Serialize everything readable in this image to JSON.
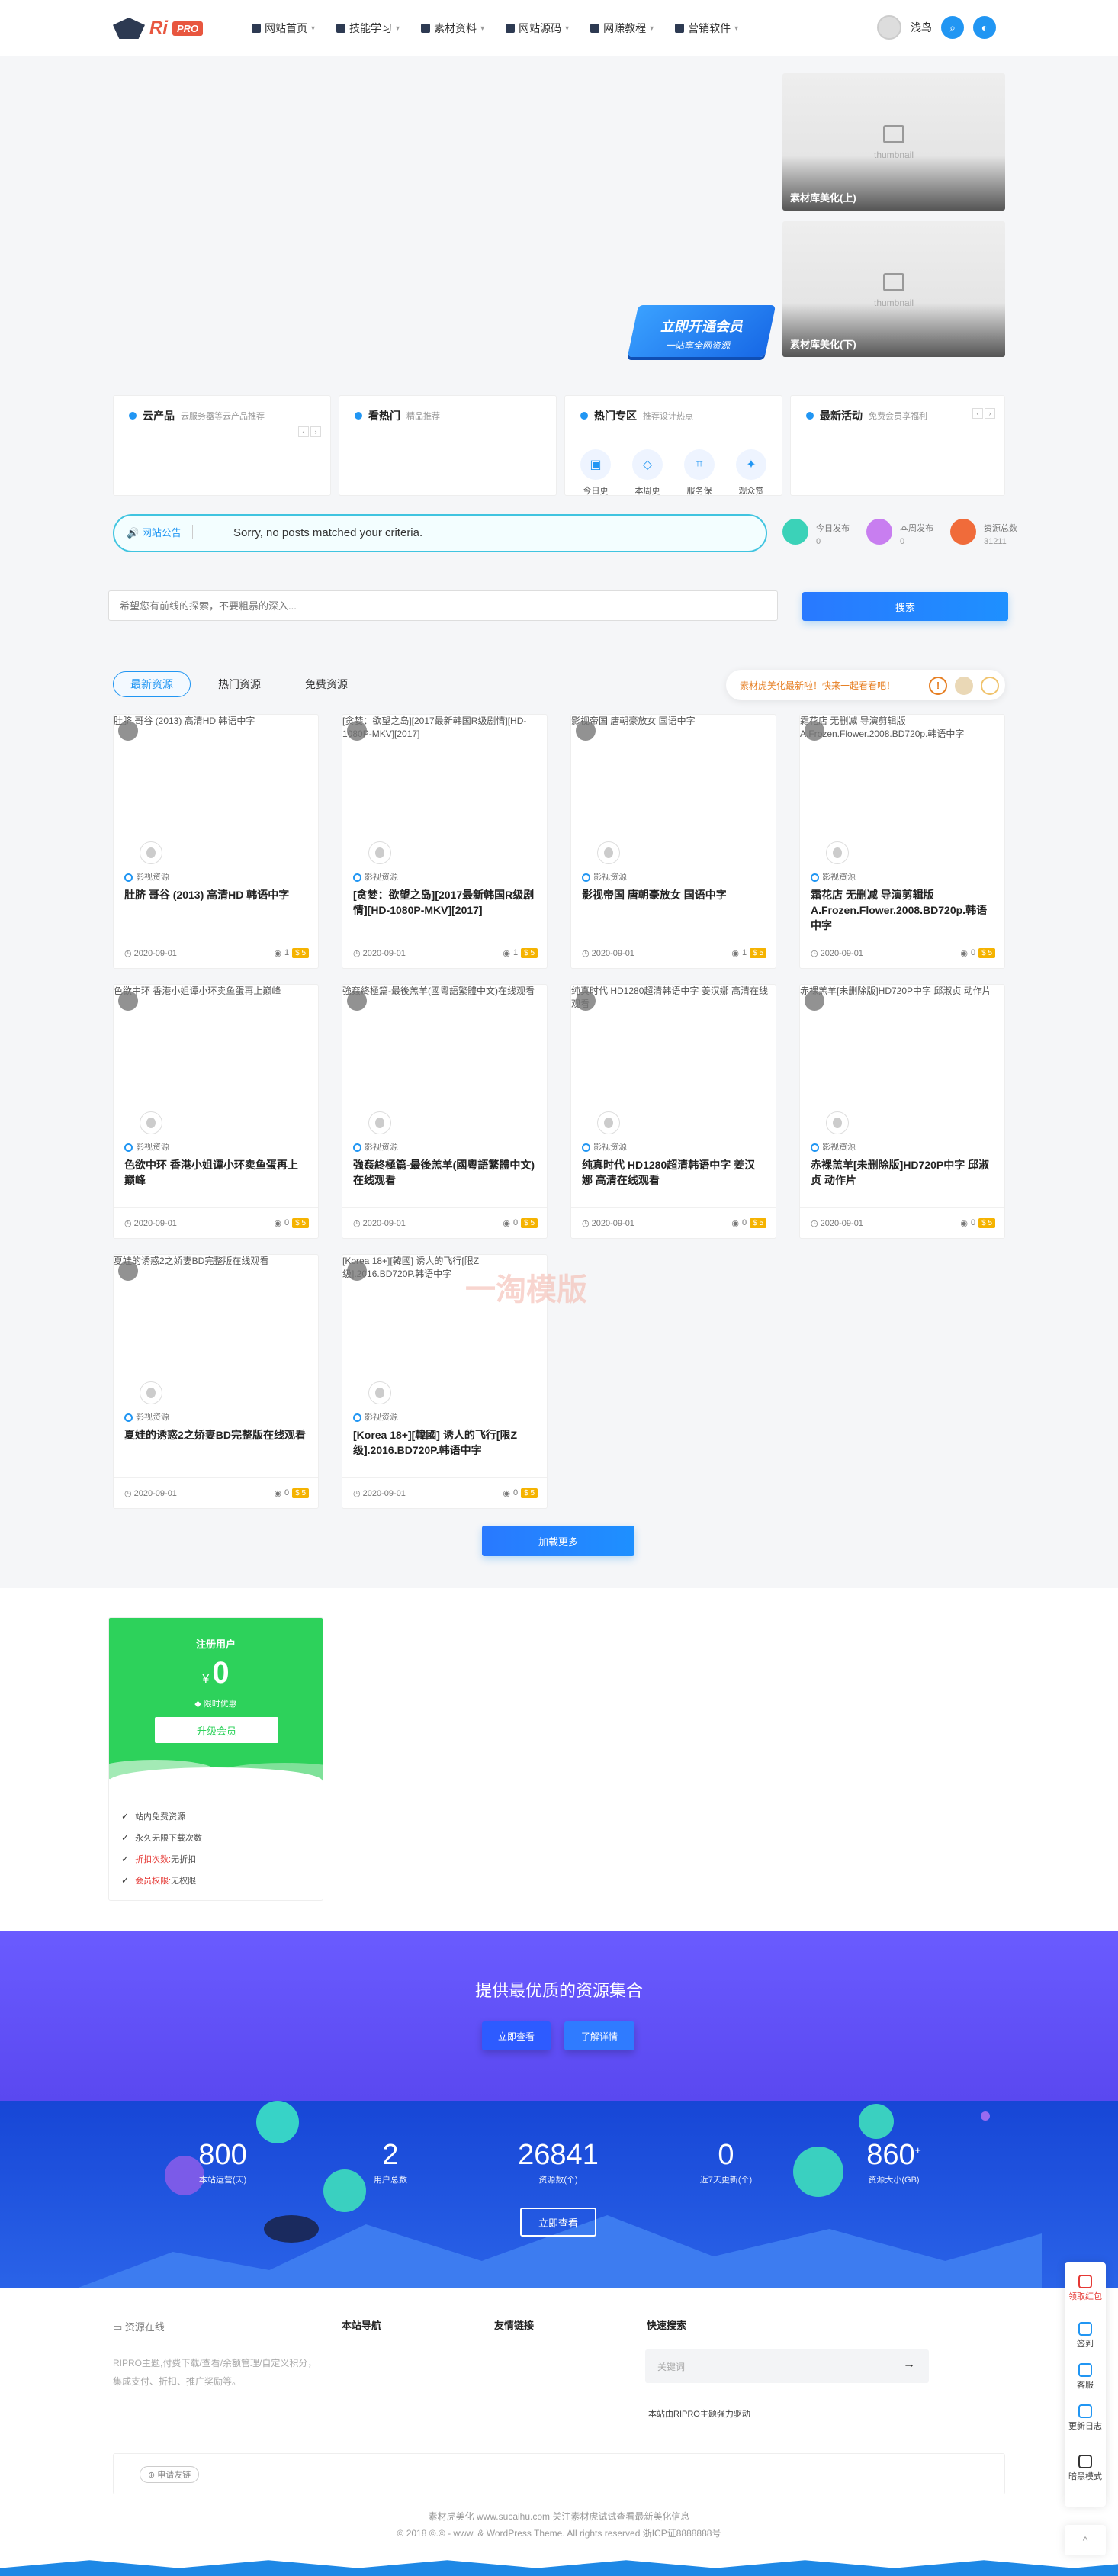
{
  "header": {
    "logo_text": "Ri",
    "logo_badge": "PRO",
    "nav": [
      {
        "label": "网站首页",
        "icon": "home-icon"
      },
      {
        "label": "技能学习",
        "icon": "send-icon"
      },
      {
        "label": "素材资料",
        "icon": "book-icon"
      },
      {
        "label": "网站源码",
        "icon": "code-icon"
      },
      {
        "label": "网赚教程",
        "icon": "grid-icon"
      },
      {
        "label": "营销软件",
        "icon": "tool-icon"
      }
    ],
    "username": "浅鸟"
  },
  "banner": {
    "thumb_placeholder": "thumbnail",
    "side_items": [
      "素材库美化(上)",
      "素材库美化(下)"
    ],
    "vip_title": "立即开通会员",
    "vip_sub": "一站享全网资源"
  },
  "boxes": [
    {
      "title": "云产品",
      "sub": "云服务器等云产品推荐"
    },
    {
      "title": "看热门",
      "sub": "精品推荐"
    },
    {
      "title": "热门专区",
      "sub": "推荐设计热点",
      "items": [
        "今日更",
        "本周更",
        "服务保",
        "观众赏"
      ]
    },
    {
      "title": "最新活动",
      "sub": "免费会员享福利"
    }
  ],
  "notice": {
    "tag": "网站公告",
    "message": "Sorry, no posts matched your criteria."
  },
  "site_stats_small": [
    {
      "label": "今日发布",
      "value": "0",
      "color": "#3bd2b8"
    },
    {
      "label": "本周发布",
      "value": "0",
      "color": "#c87ef0"
    },
    {
      "label": "资源总数",
      "value": "31211",
      "color": "#f06b3a"
    }
  ],
  "search": {
    "placeholder": "希望您有前线的探索，不要粗暴的深入...",
    "button": "搜索"
  },
  "tabs": [
    "最新资源",
    "热门资源",
    "免费资源"
  ],
  "promo": {
    "text": "素材虎美化最新啦！快来一起看看吧！",
    "icon": "!"
  },
  "posts": [
    {
      "img_alt": "肚脐 哥谷 (2013) 高清HD 韩语中字",
      "cat": "影视资源",
      "title": "肚脐 哥谷 (2013) 高清HD 韩语中字",
      "date": "2020-09-01",
      "views": "1",
      "price": "5"
    },
    {
      "img_alt": "[贪婪：欲望之岛][2017最新韩国R级剧情][HD-1080P-MKV][2017]",
      "cat": "影视资源",
      "title": "[贪婪：欲望之岛][2017最新韩国R级剧情][HD-1080P-MKV][2017]",
      "date": "2020-09-01",
      "views": "1",
      "price": "5"
    },
    {
      "img_alt": "影视帝国 唐朝豪放女 国语中字",
      "cat": "影视资源",
      "title": "影视帝国 唐朝豪放女 国语中字",
      "date": "2020-09-01",
      "views": "1",
      "price": "5"
    },
    {
      "img_alt": "霜花店 无删减 导演剪辑版 A.Frozen.Flower.2008.BD720p.韩语中字",
      "cat": "影视资源",
      "title": "霜花店 无删减 导演剪辑版 A.Frozen.Flower.2008.BD720p.韩语中字",
      "date": "2020-09-01",
      "views": "0",
      "price": "5"
    },
    {
      "img_alt": "色欲中环 香港小姐谭小环卖鱼蛋再上巅峰",
      "cat": "影视资源",
      "title": "色欲中环 香港小姐谭小环卖鱼蛋再上巅峰",
      "date": "2020-09-01",
      "views": "0",
      "price": "5"
    },
    {
      "img_alt": "強姦終極篇-最後羔羊(國粵語繁體中文)在线观看",
      "cat": "影视资源",
      "title": "強姦終極篇-最後羔羊(國粵語繁體中文) 在线观看",
      "date": "2020-09-01",
      "views": "0",
      "price": "5"
    },
    {
      "img_alt": "纯真时代 HD1280超清韩语中字 姜汉娜 高清在线观看",
      "cat": "影视资源",
      "title": "纯真时代 HD1280超清韩语中字 姜汉娜 高清在线观看",
      "date": "2020-09-01",
      "views": "0",
      "price": "5"
    },
    {
      "img_alt": "赤裸羔羊[未删除版]HD720P中字 邱淑贞 动作片",
      "cat": "影视资源",
      "title": "赤裸羔羊[未删除版]HD720P中字 邱淑贞 动作片",
      "date": "2020-09-01",
      "views": "0",
      "price": "5"
    },
    {
      "img_alt": "夏娃的诱惑2之娇妻BD完整版在线观看",
      "cat": "影视资源",
      "title": "夏娃的诱惑2之娇妻BD完整版在线观看",
      "date": "2020-09-01",
      "views": "0",
      "price": "5"
    },
    {
      "img_alt": "[Korea 18+][韓國] 诱人的飞行[限Z级].2016.BD720P.韩语中字",
      "cat": "影视资源",
      "title": "[Korea 18+][韓國] 诱人的飞行[限Z级].2016.BD720P.韩语中字",
      "date": "2020-09-01",
      "views": "0",
      "price": "5"
    }
  ],
  "watermark": "一淘模版",
  "load_more": "加载更多",
  "member": {
    "name": "注册用户",
    "currency": "¥",
    "price": "0",
    "time": "限时优惠",
    "button": "升级会员",
    "features": [
      {
        "label": "站内免费资源",
        "value": ""
      },
      {
        "label": "永久无限下载次数",
        "value": ""
      },
      {
        "label": "折扣次数:",
        "value": "无折扣"
      },
      {
        "label": "会员权限:",
        "value": "无权限"
      }
    ]
  },
  "cta": {
    "title": "提供最优质的资源集合",
    "btn1": "立即查看",
    "btn2": "了解详情"
  },
  "big_stats": [
    {
      "value": "800",
      "label": "本站运营(天)"
    },
    {
      "value": "2",
      "label": "用户总数"
    },
    {
      "value": "26841",
      "label": "资源数(个)"
    },
    {
      "value": "0",
      "label": "近7天更新(个)"
    },
    {
      "value": "860",
      "sup": "+",
      "label": "资源大小(GB)"
    }
  ],
  "stats_button": "立即查看",
  "footer": {
    "logo_alt": "资源在线",
    "desc": "RIPRO主题,付费下载/查看/余额管理/自定义积分，集成支付、折扣、推广奖励等。",
    "col1": "本站导航",
    "col2": "友情链接",
    "col3": "快速搜索",
    "search_placeholder": "关键词",
    "search_arrow": "→",
    "powered": "本站由RIPRO主题强力驱动",
    "link_button": "申请友链",
    "copyright1": "素材虎美化 www.sucaihu.com 关注素材虎试试查看最新美化信息",
    "copyright2": "© 2018 ©.© - www. & WordPress Theme. All rights reserved 浙ICP证8888888号"
  },
  "sidebar": [
    {
      "label": "领取红包",
      "color": "#e53935"
    },
    {
      "label": "签到",
      "color": "#2196f3"
    },
    {
      "label": "客服",
      "color": "#2196f3"
    },
    {
      "label": "更新日志",
      "color": "#2196f3"
    },
    {
      "label": "暗黑模式",
      "color": "#333333"
    }
  ],
  "back_to_top": "^"
}
